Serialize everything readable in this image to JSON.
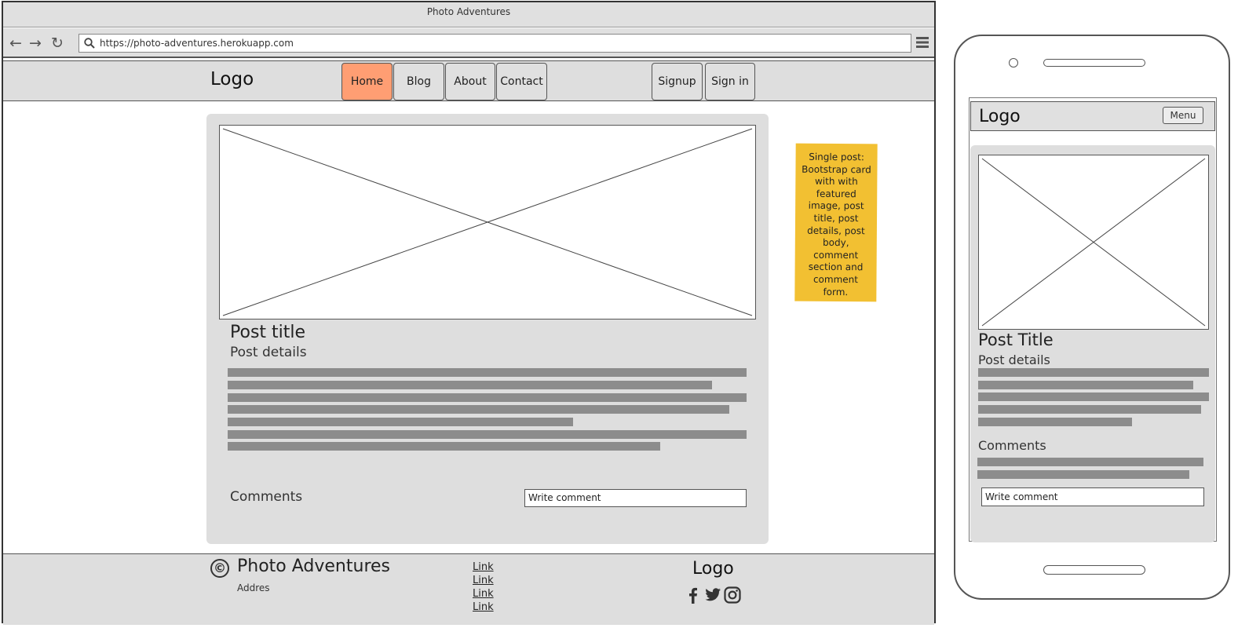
{
  "browser": {
    "window_title": "Photo Adventures",
    "url": "https://photo-adventures.herokuapp.com",
    "icons": [
      "back-icon",
      "forward-icon",
      "reload-icon",
      "search-icon",
      "hamburger-menu-icon"
    ]
  },
  "nav": {
    "logo": "Logo",
    "items": [
      {
        "label": "Home",
        "active": true
      },
      {
        "label": "Blog",
        "active": false
      },
      {
        "label": "About",
        "active": false
      },
      {
        "label": "Contact",
        "active": false
      }
    ],
    "auth": [
      {
        "label": "Signup"
      },
      {
        "label": "Sign in"
      }
    ],
    "active_color": "#ff9e73"
  },
  "post": {
    "title": "Post title",
    "details": "Post details",
    "comments_label": "Comments",
    "comment_placeholder": "Write comment"
  },
  "note": {
    "text": "Single post: Bootstrap card with with featured image, post title, post details, post body, comment section and comment form.",
    "color": "#f2c032"
  },
  "footer": {
    "copyright_symbol": "©",
    "brand": "Photo Adventures",
    "address": "Addres",
    "links": [
      "Link",
      "Link",
      "Link",
      "Link"
    ],
    "logo": "Logo",
    "social_icons": [
      "facebook-icon",
      "twitter-icon",
      "instagram-icon"
    ]
  },
  "mobile": {
    "logo": "Logo",
    "menu_label": "Menu",
    "post_title": "Post Title",
    "post_details": "Post details",
    "comments_label": "Comments",
    "comment_placeholder": "Write comment"
  }
}
